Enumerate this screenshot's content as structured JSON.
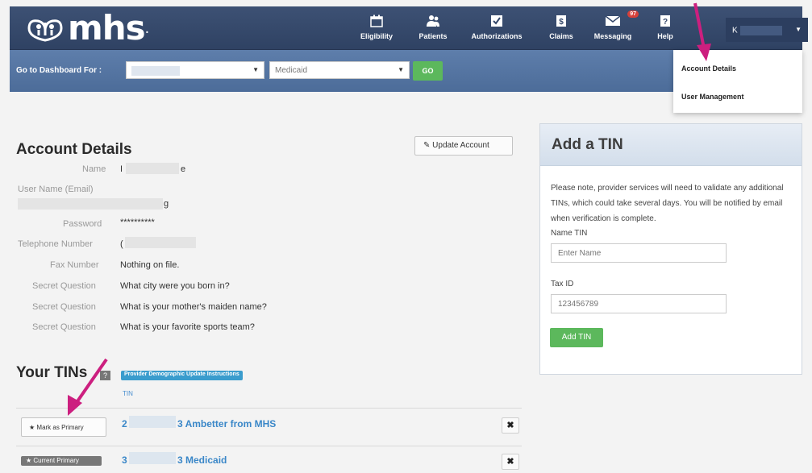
{
  "brand": {
    "logo_text": "mhs",
    "logo_dot": "."
  },
  "nav": {
    "items": [
      {
        "label": "Eligibility",
        "icon": "calendar-icon"
      },
      {
        "label": "Patients",
        "icon": "people-icon"
      },
      {
        "label": "Authorizations",
        "icon": "checkbox-icon"
      },
      {
        "label": "Claims",
        "icon": "claims-icon"
      },
      {
        "label": "Messaging",
        "icon": "envelope-icon",
        "badge": "97"
      },
      {
        "label": "Help",
        "icon": "help-icon"
      }
    ],
    "user_initial": "K"
  },
  "subnav": {
    "label": "Go to Dashboard For :",
    "plan_select": "Medicaid",
    "go_label": "GO"
  },
  "dropdown": {
    "items": [
      "Account Details",
      "User Management"
    ]
  },
  "account": {
    "title": "Account Details",
    "update_label": "Update Account",
    "rows": [
      {
        "label": "Name",
        "value": "e"
      },
      {
        "label": "User Name (Email)",
        "value": "g"
      },
      {
        "label": "Password",
        "value": "**********"
      },
      {
        "label": "Telephone Number",
        "value": "("
      },
      {
        "label": "Fax Number",
        "value": "Nothing on file."
      },
      {
        "label": "Secret Question",
        "value": "What city were you born in?"
      },
      {
        "label": "Secret Question",
        "value": "What is your mother's maiden name?"
      },
      {
        "label": "Secret Question",
        "value": "What is your favorite sports team?"
      }
    ]
  },
  "tins": {
    "title": "Your TINs",
    "help_glyph": "?",
    "instructions_badge": "Provider Demographic Update Instructions",
    "small_link": "TIN",
    "mark_primary_label": "Mark as Primary",
    "current_primary_label": "Current Primary",
    "rows": [
      {
        "lead": "2",
        "tail": "3 Ambetter from MHS"
      },
      {
        "lead": "3",
        "tail": "3 Medicaid"
      }
    ]
  },
  "add_tin": {
    "title": "Add a TIN",
    "note": "Please note, provider services will need to validate any additional TINs, which could take several days. You will be notified by email when verification is complete.",
    "name_label": "Name TIN",
    "name_placeholder": "Enter Name",
    "taxid_label": "Tax ID",
    "taxid_placeholder": "123456789",
    "button_label": "Add TIN"
  },
  "colors": {
    "nav_bg": "#34476a",
    "subnav_bg": "#577aa7",
    "accent_green": "#5cb85c",
    "link_blue": "#3a87c8",
    "annotation_arrow": "#cc1f7f"
  }
}
